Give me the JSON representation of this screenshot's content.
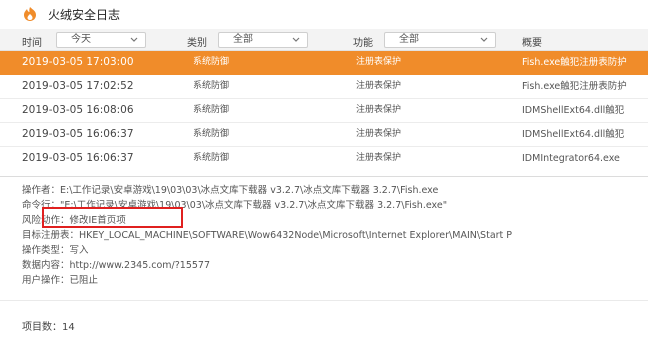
{
  "app": {
    "title": "火绒安全日志",
    "accent": "#f08c2a"
  },
  "filters": {
    "time_label": "时间",
    "time_value": "今天",
    "category_label": "类别",
    "category_value": "全部",
    "function_label": "功能",
    "function_value": "全部",
    "summary_header": "概要"
  },
  "rows": [
    {
      "time": "2019-03-05 17:03:00",
      "category": "系统防御",
      "function": "注册表保护",
      "summary": "Fish.exe触犯注册表防护",
      "selected": true
    },
    {
      "time": "2019-03-05 17:02:52",
      "category": "系统防御",
      "function": "注册表保护",
      "summary": "Fish.exe触犯注册表防护",
      "selected": false
    },
    {
      "time": "2019-03-05 16:08:06",
      "category": "系统防御",
      "function": "注册表保护",
      "summary": "IDMShellExt64.dll触犯",
      "selected": false
    },
    {
      "time": "2019-03-05 16:06:37",
      "category": "系统防御",
      "function": "注册表保护",
      "summary": "IDMShellExt64.dll触犯",
      "selected": false
    },
    {
      "time": "2019-03-05 16:06:37",
      "category": "系统防御",
      "function": "注册表保护",
      "summary": "IDMIntegrator64.exe",
      "selected": false
    }
  ],
  "detail": {
    "operator": "操作者：E:\\工作记录\\安卓游戏\\19\\03\\03\\冰点文库下载器 v3.2.7\\冰点文库下载器 3.2.7\\Fish.exe",
    "command": "命令行：\"E:\\工作记录\\安卓游戏\\19\\03\\03\\冰点文库下载器 v3.2.7\\冰点文库下载器 3.2.7\\Fish.exe\"",
    "risk": "风险动作：修改IE首页项",
    "target": "目标注册表：HKEY_LOCAL_MACHINE\\SOFTWARE\\Wow6432Node\\Microsoft\\Internet Explorer\\MAIN\\Start P",
    "op_type": "操作类型：写入",
    "data": "数据内容：http://www.2345.com/?15577",
    "user_action": "用户操作：已阻止"
  },
  "footer": {
    "item_count": "项目数：14"
  }
}
